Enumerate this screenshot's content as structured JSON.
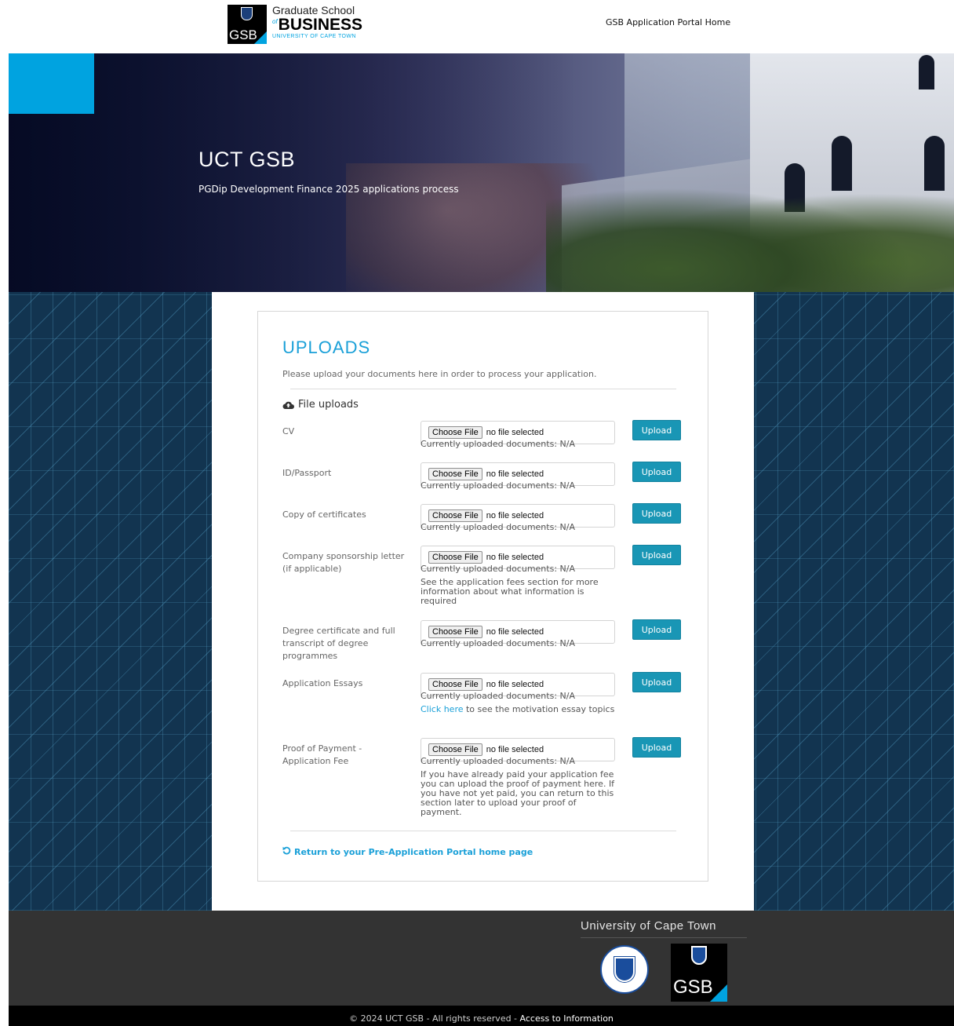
{
  "header": {
    "logo": {
      "badge_text": "GSB",
      "line1": "Graduate School",
      "of": "of",
      "line2": "BUSINESS",
      "line3": "UNIVERSITY OF CAPE TOWN"
    },
    "home_link": "GSB Application Portal Home"
  },
  "hero": {
    "title": "UCT GSB",
    "subtitle": "PGDip Development Finance 2025 applications process"
  },
  "uploads": {
    "title": "UPLOADS",
    "description": "Please upload your documents here in order to process your application.",
    "section_title": "File uploads",
    "section_icon": "cloud-upload-icon",
    "choose_label": "Choose File",
    "no_file_label": "no file selected",
    "upload_label": "Upload",
    "current_label": "Currently uploaded documents: N/A",
    "rows": [
      {
        "label": "CV",
        "help": ""
      },
      {
        "label": "ID/Passport",
        "help": ""
      },
      {
        "label": "Copy of certificates",
        "help": ""
      },
      {
        "label": "Company sponsorship letter (if applicable)",
        "help": "See the application fees section for more information about what information is required"
      },
      {
        "label": "Degree certificate and full transcript of degree programmes",
        "help": ""
      },
      {
        "label": "Application Essays",
        "help_link": "Click here",
        "help": " to see the motivation essay topics"
      },
      {
        "label": "Proof of Payment - Application Fee",
        "help": "If you have already paid your application fee you can upload the proof of payment here. If you have not yet paid, you can return to this section later to upload your proof of payment."
      }
    ],
    "return_link": "Return to your Pre-Application Portal home page",
    "return_icon": "undo-icon"
  },
  "footer": {
    "university": "University of Cape Town",
    "gsb_badge_text": "GSB",
    "copyright": "© 2024 UCT GSB - All rights reserved - ",
    "access_link": "Access to Information"
  },
  "colors": {
    "accent_blue": "#1aa0d8",
    "upload_button": "#1996b5",
    "brand_cyan": "#00a3e0",
    "pattern_bg": "#123450",
    "footer_bg": "#333333"
  }
}
